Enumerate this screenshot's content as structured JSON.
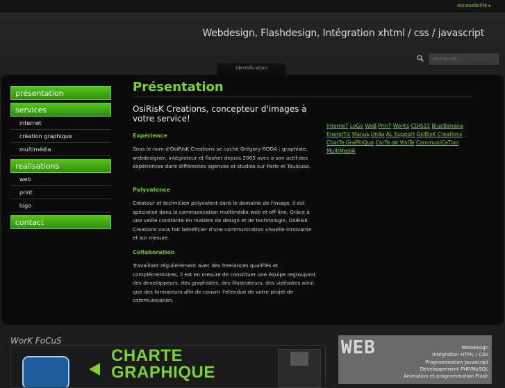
{
  "topbar": {
    "accessibility": "Accessibilité ▸"
  },
  "header": {
    "tagline": "Webdesign, Flashdesign, Intégration xhtml / css / javascript",
    "search_placeholder": "recherche ...",
    "identification": "Identification"
  },
  "nav": [
    {
      "label": "présentation",
      "subs": []
    },
    {
      "label": "services",
      "subs": [
        "internet",
        "création graphique",
        "multimédia"
      ]
    },
    {
      "label": "realisations",
      "subs": [
        "web",
        "print",
        "logo"
      ]
    },
    {
      "label": "contact",
      "subs": []
    }
  ],
  "content": {
    "title": "Présentation",
    "subtitle": "OsiRisK Creations, concepteur d'images à votre service!",
    "sections": [
      {
        "heading": "Expérience",
        "body": "Sous le nom d'OsiRisK Creations se cache Grégory RODA : graphiste, webdesigner, intégrateur et flasher depuis 2005 avec à son actif des expériences dans différentes agences et studios sur Paris et Toulouse."
      },
      {
        "heading": "Polyvalence",
        "body": "Créateur et technicien polyvalent dans le domaine de l'image, il est spécialisé dans la communication multimédia web et off-line. Grâce à une veille constante en matière de design et de technologie, OsiRisK Creations vous fait bénéficier d'une communication visuelle innovante et sur mesure."
      },
      {
        "heading": "Collaboration",
        "body": "Travaillant régulièrement avec des freelances qualifiés et complémentaires, il est en mesure de constituer une équipe regroupant des developpeurs, des graphistes, des illustrateurs, des vidéastes ainsi que des formateurs afin de couvrir l'étendue de votre projet de communication."
      }
    ],
    "tags": [
      "InterneT",
      "LoGo",
      "WeB",
      "PrinT",
      "WorKs",
      "CDIS31",
      "BlueBanana",
      "EnergiTic",
      "Manus",
      "Unda",
      "AL Support",
      "OsiRisK Creations",
      "CharTe GraPhiQue",
      "CarTe de VisiTe",
      "CommuniCaTion",
      "MultiMediA"
    ]
  },
  "focus": {
    "title": "WorK FoCuS",
    "banner_line1": "CHARTE",
    "banner_line2": "GRAPHIQUE"
  },
  "right_panel": {
    "logo_text": "WEB",
    "skills": [
      "Webdesign",
      "Intégration HTML / CSS",
      "Programmation Javascript",
      "Développement PHP/MySQL",
      "Animation et programmation Flash"
    ]
  },
  "colors": {
    "accent": "#7ad62a",
    "background": "#1c1c1c"
  }
}
